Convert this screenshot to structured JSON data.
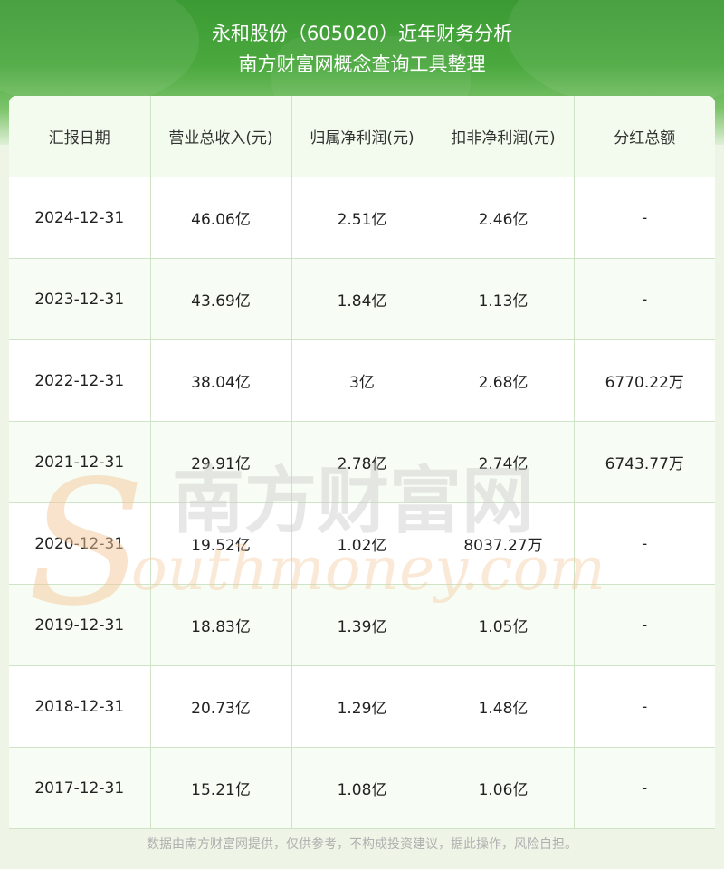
{
  "header": {
    "line1": "永和股份（605020）近年财务分析",
    "line2": "南方财富网概念查询工具整理"
  },
  "table": {
    "columns": [
      "汇报日期",
      "营业总收入(元)",
      "归属净利润(元)",
      "扣非净利润(元)",
      "分红总额"
    ],
    "rows": [
      [
        "2024-12-31",
        "46.06亿",
        "2.51亿",
        "2.46亿",
        "-"
      ],
      [
        "2023-12-31",
        "43.69亿",
        "1.84亿",
        "1.13亿",
        "-"
      ],
      [
        "2022-12-31",
        "38.04亿",
        "3亿",
        "2.68亿",
        "6770.22万"
      ],
      [
        "2021-12-31",
        "29.91亿",
        "2.78亿",
        "2.74亿",
        "6743.77万"
      ],
      [
        "2020-12-31",
        "19.52亿",
        "1.02亿",
        "8037.27万",
        "-"
      ],
      [
        "2019-12-31",
        "18.83亿",
        "1.39亿",
        "1.05亿",
        "-"
      ],
      [
        "2018-12-31",
        "20.73亿",
        "1.29亿",
        "1.48亿",
        "-"
      ],
      [
        "2017-12-31",
        "15.21亿",
        "1.08亿",
        "1.06亿",
        "-"
      ]
    ]
  },
  "watermark": {
    "cn": "南方财富网",
    "en": "outhmoney.com",
    "s_letter": "S"
  },
  "footer": {
    "disclaimer": "数据由南方财富网提供，仅供参考，不构成投资建议，据此操作，风险自担。"
  },
  "colors": {
    "header_green": "#3c9a34",
    "grid_line": "#cfe3c6",
    "watermark_orange": "#f4c89a",
    "watermark_gray": "#d9d9d9"
  }
}
